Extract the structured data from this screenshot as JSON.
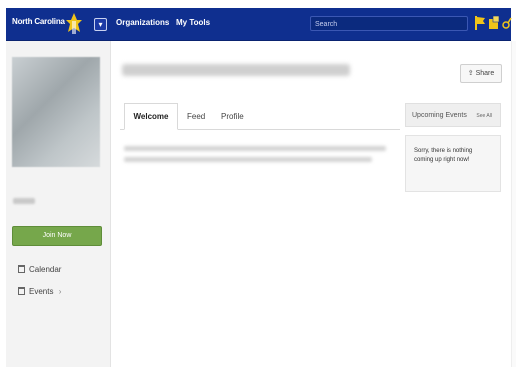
{
  "topbar": {
    "brand": "North Carolina",
    "nav": [
      "Organizations",
      "My Tools"
    ],
    "search_placeholder": "Search",
    "colors": {
      "bar": "#0f2f8f",
      "icon": "#f0c419"
    },
    "icons": [
      "mascot-icon",
      "menu-icon",
      "flag-icon",
      "notifications-icon",
      "settings-icon"
    ]
  },
  "sidebar": {
    "join_label": "Join Now",
    "links": [
      {
        "label": "Calendar",
        "icon": "calendar-icon"
      },
      {
        "label": "Events",
        "icon": "events-icon",
        "suffix": "›"
      }
    ],
    "join_color": "#76a74b"
  },
  "main": {
    "share_label": "Share",
    "tabs": [
      "Welcome",
      "Feed",
      "Profile"
    ],
    "events": {
      "title": "Upcoming Events",
      "see_all": "See All",
      "empty_message": "Sorry, there is nothing coming up right now!"
    }
  }
}
